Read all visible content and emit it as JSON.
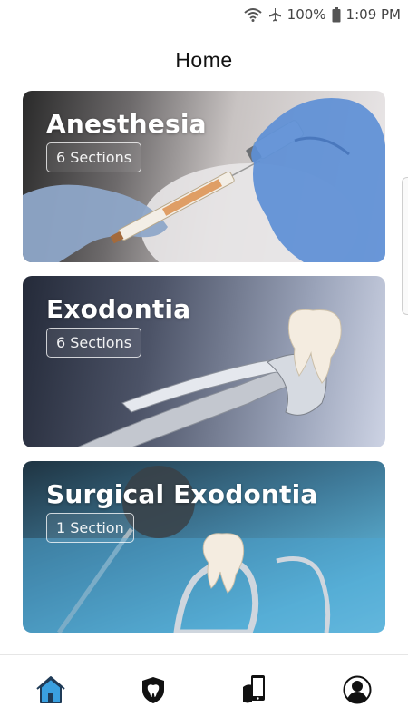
{
  "status_bar": {
    "battery_percent": "100%",
    "time": "1:09 PM",
    "icons": [
      "wifi-icon",
      "airplane-icon",
      "battery-icon"
    ]
  },
  "header": {
    "title": "Home"
  },
  "cards": [
    {
      "title": "Anesthesia",
      "sections": "6 Sections",
      "image": "syringe-vial-image"
    },
    {
      "title": "Exodontia",
      "sections": "6 Sections",
      "image": "forceps-tooth-image"
    },
    {
      "title": "Surgical Exodontia",
      "sections": "1 Section",
      "image": "extracted-tooth-tray-image"
    }
  ],
  "bottom_nav": {
    "items": [
      {
        "icon": "home-icon",
        "active": true
      },
      {
        "icon": "tooth-shield-icon",
        "active": false
      },
      {
        "icon": "phone-hand-icon",
        "active": false
      },
      {
        "icon": "profile-icon",
        "active": false
      }
    ]
  },
  "colors": {
    "accent": "#3aa0e0",
    "text": "#111111",
    "icon_dark": "#111111"
  }
}
